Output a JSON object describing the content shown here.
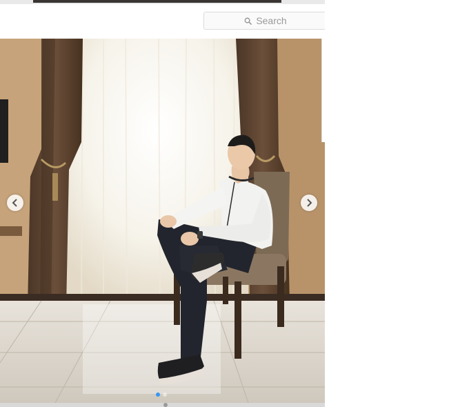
{
  "search": {
    "placeholder": "Search",
    "icon": "search-icon"
  },
  "photo": {
    "icon_prev": "chevron-left-icon",
    "icon_next": "chevron-right-icon",
    "carousel": {
      "total": 2,
      "active_index": 0
    }
  },
  "colors": {
    "accent": "#3897f0",
    "wall": "#c9a57b",
    "curtain": "#5a4230",
    "window_light": "#fbf8ef"
  }
}
